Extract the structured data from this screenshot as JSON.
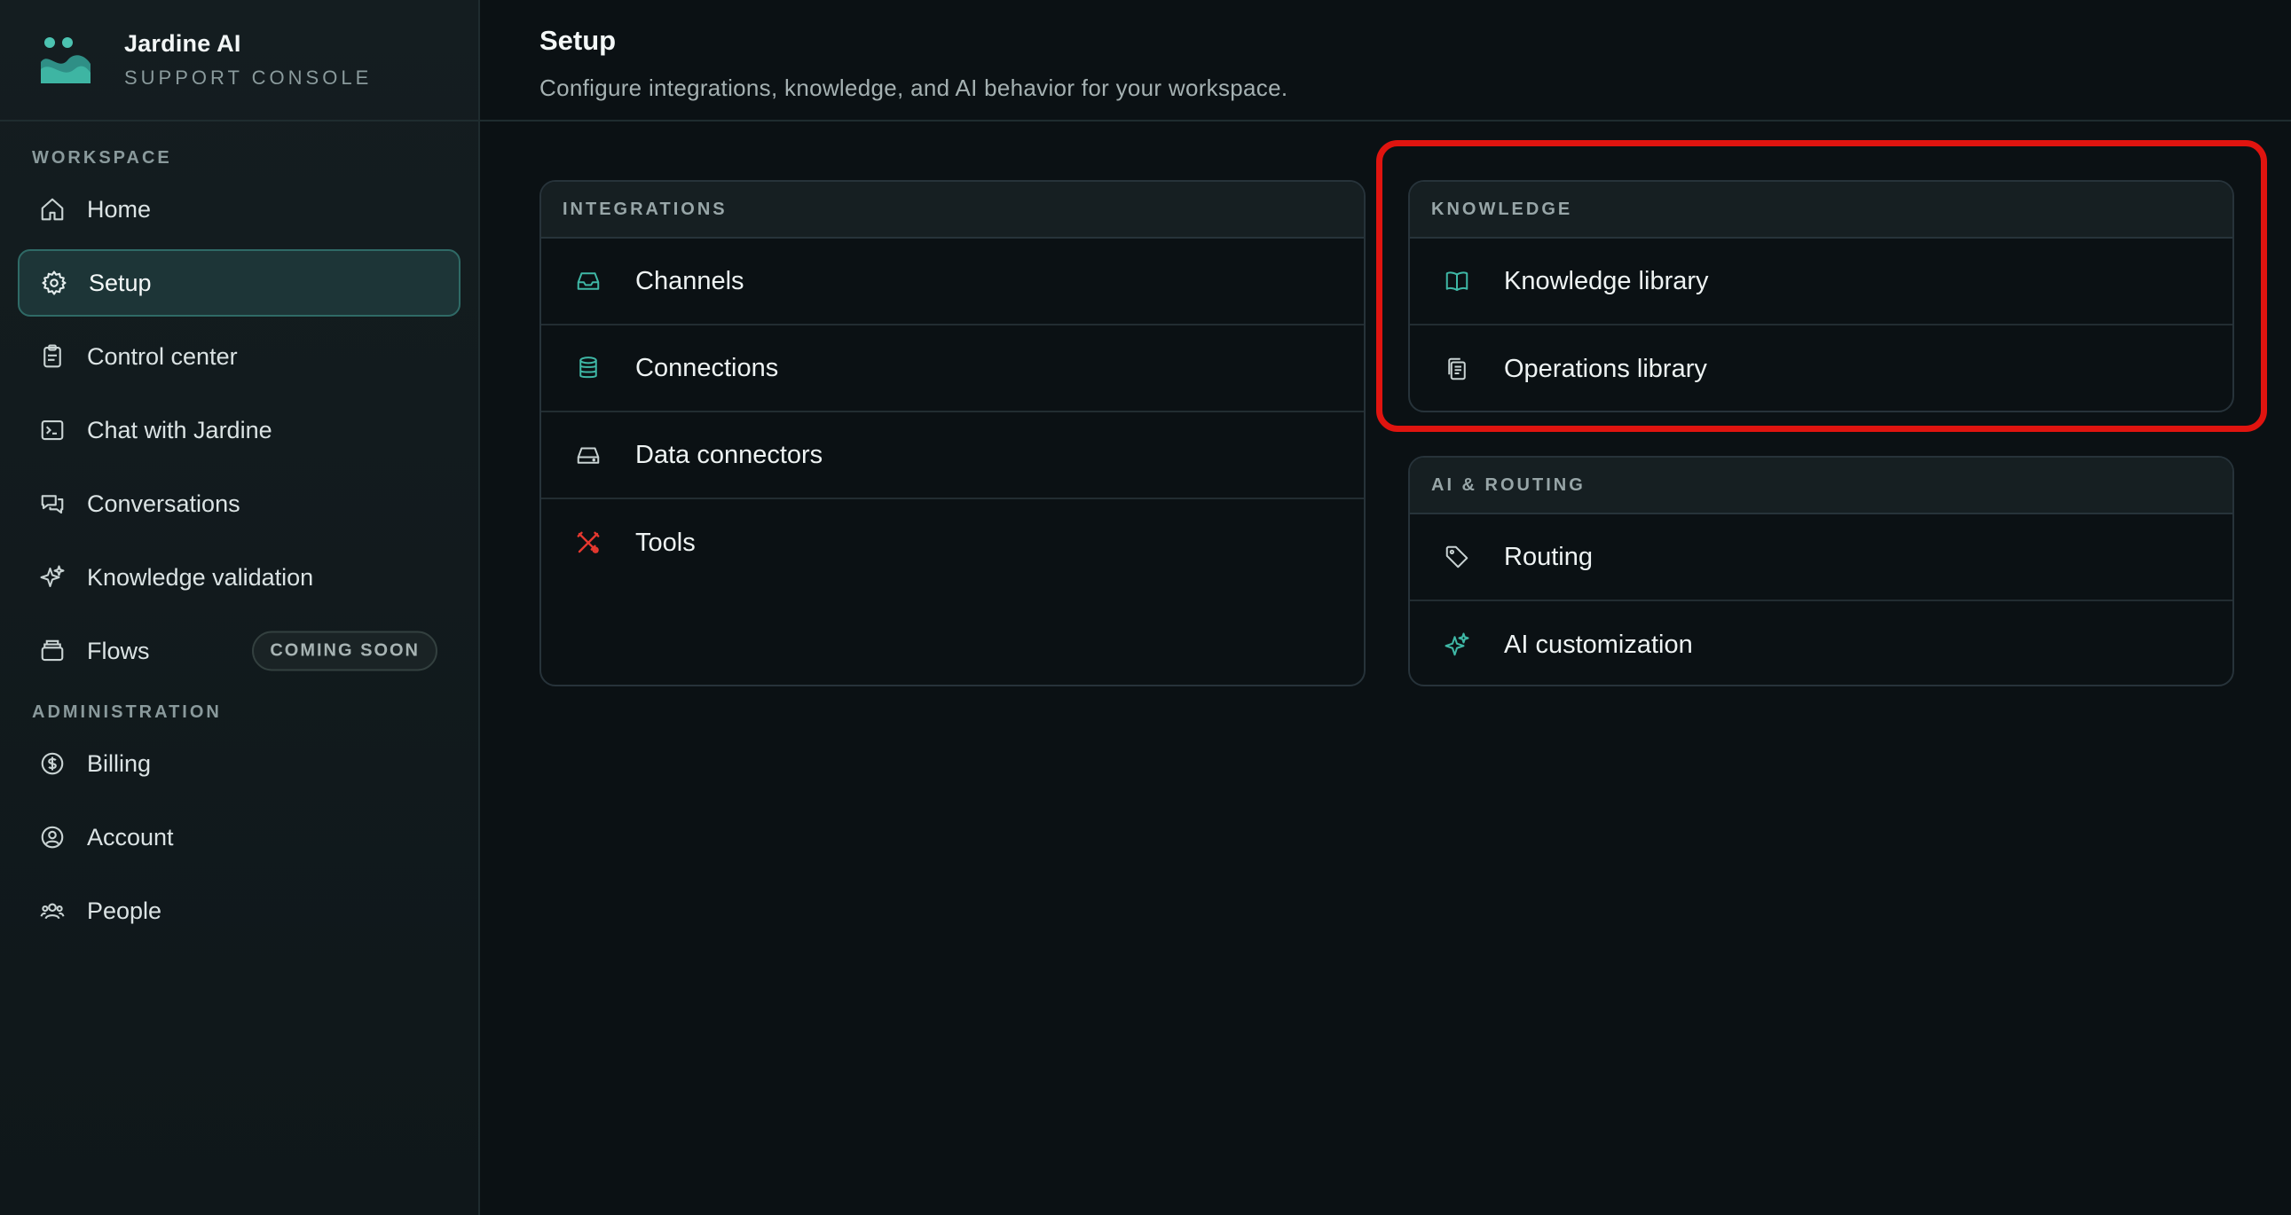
{
  "brand": {
    "name": "Jardine AI",
    "subtitle": "SUPPORT CONSOLE"
  },
  "sidebar": {
    "workspace_label": "WORKSPACE",
    "workspace_items": [
      {
        "label": "Home",
        "icon": "home-icon"
      },
      {
        "label": "Setup",
        "icon": "gear-icon",
        "active": true
      },
      {
        "label": "Control center",
        "icon": "clipboard-icon"
      },
      {
        "label": "Chat with Jardine",
        "icon": "terminal-icon"
      },
      {
        "label": "Conversations",
        "icon": "chat-bubbles-icon"
      },
      {
        "label": "Knowledge validation",
        "icon": "sparkle-icon"
      },
      {
        "label": "Flows",
        "icon": "stack-icon",
        "badge": "COMING SOON"
      }
    ],
    "admin_label": "ADMINISTRATION",
    "admin_items": [
      {
        "label": "Billing",
        "icon": "dollar-circle-icon"
      },
      {
        "label": "Account",
        "icon": "user-circle-icon"
      },
      {
        "label": "People",
        "icon": "users-icon"
      }
    ]
  },
  "header": {
    "title": "Setup",
    "subtitle": "Configure integrations, knowledge, and AI behavior for your workspace."
  },
  "cards": {
    "integrations": {
      "title": "INTEGRATIONS",
      "items": [
        {
          "label": "Channels",
          "icon": "inbox-icon"
        },
        {
          "label": "Connections",
          "icon": "database-icon"
        },
        {
          "label": "Data connectors",
          "icon": "hard-drive-icon"
        },
        {
          "label": "Tools",
          "icon": "tools-icon"
        }
      ]
    },
    "knowledge": {
      "title": "KNOWLEDGE",
      "items": [
        {
          "label": "Knowledge library",
          "icon": "book-open-icon"
        },
        {
          "label": "Operations library",
          "icon": "documents-icon"
        }
      ]
    },
    "ai_routing": {
      "title": "AI & ROUTING",
      "items": [
        {
          "label": "Routing",
          "icon": "tag-icon"
        },
        {
          "label": "AI customization",
          "icon": "sparkles-icon"
        }
      ]
    }
  },
  "colors": {
    "accent": "#3fb8a6",
    "highlight": "#e0140f",
    "tools_icon": "#e5382f"
  }
}
